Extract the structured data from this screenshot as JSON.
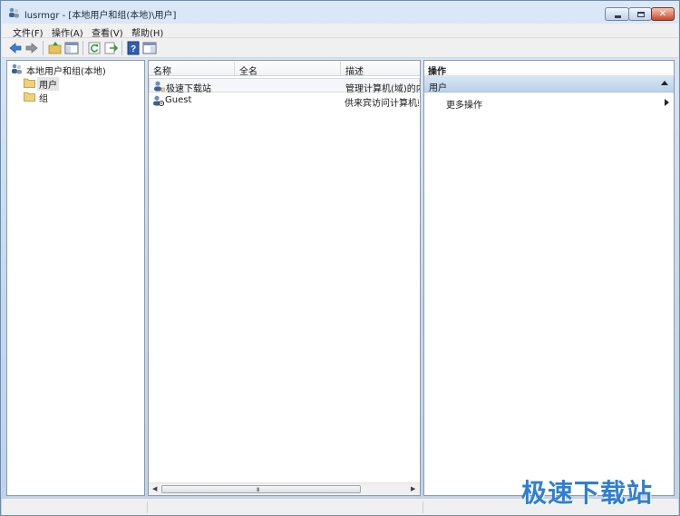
{
  "window": {
    "title": "lusrmgr - [本地用户和组(本地)\\用户]",
    "close_glyph": "✕"
  },
  "menu": [
    "文件(F)",
    "操作(A)",
    "查看(V)",
    "帮助(H)"
  ],
  "toolbar": {
    "icons": [
      "back-arrow-icon",
      "forward-arrow-icon",
      "up-folder-icon",
      "show-hide-tree-icon",
      "refresh-icon",
      "export-list-icon",
      "help-icon",
      "show-hide-action-pane-icon"
    ]
  },
  "tree": {
    "root": "本地用户和组(本地)",
    "items": [
      "用户",
      "组"
    ],
    "selected": "用户"
  },
  "list": {
    "columns": [
      "名称",
      "全名",
      "描述"
    ],
    "rows": [
      {
        "name": "极速下载站",
        "full_name": "",
        "description": "管理计算机(域)的内"
      },
      {
        "name": "Guest",
        "full_name": "",
        "description": "供来宾访问计算机或"
      }
    ],
    "scroll_grip": "III"
  },
  "actions": {
    "header": "操作",
    "section": "用户",
    "items": [
      "更多操作"
    ]
  },
  "watermark": "极速下载站",
  "colors": {
    "accent": "#2f7fd2",
    "folder": "#e8c25a",
    "selection": "#e5e5e5"
  }
}
